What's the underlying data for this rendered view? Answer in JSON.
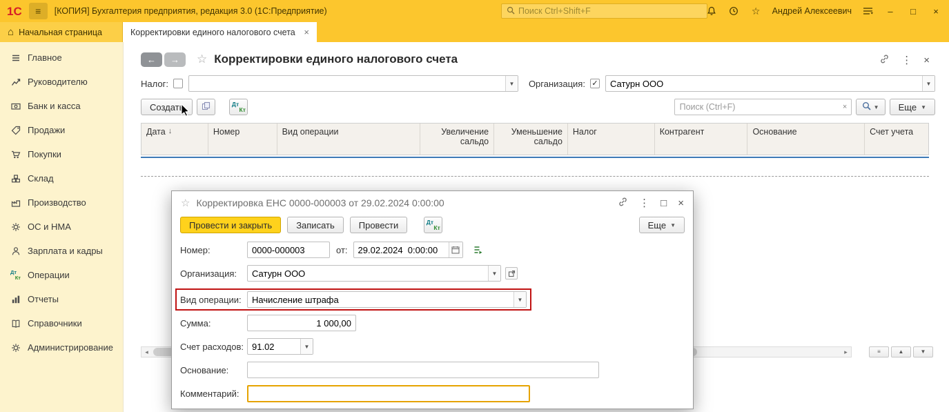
{
  "topbar": {
    "logo": "1С",
    "title": "[КОПИЯ] Бухгалтерия предприятия, редакция 3.0  (1С:Предприятие)",
    "search_placeholder": "Поиск Ctrl+Shift+F",
    "user_name": "Андрей Алексеевич"
  },
  "tabs": {
    "home": "Начальная страница",
    "active": "Корректировки единого налогового счета"
  },
  "sidebar": {
    "items": [
      "Главное",
      "Руководителю",
      "Банк и касса",
      "Продажи",
      "Покупки",
      "Склад",
      "Производство",
      "ОС и НМА",
      "Зарплата и кадры",
      "Операции",
      "Отчеты",
      "Справочники",
      "Администрирование"
    ]
  },
  "list": {
    "title": "Корректировки единого налогового счета",
    "tax_label": "Налог:",
    "org_label": "Организация:",
    "org_value": "Сатурн ООО",
    "create_button": "Создать",
    "search_placeholder": "Поиск (Ctrl+F)",
    "more_button": "Еще",
    "columns": [
      "Дата",
      "Номер",
      "Вид операции",
      "Увеличение сальдо",
      "Уменьшение сальдо",
      "Налог",
      "Контрагент",
      "Основание",
      "Счет учета"
    ],
    "rows": []
  },
  "dialog": {
    "title": "Корректировка ЕНС 0000-000003 от 29.02.2024 0:00:00",
    "buttons": {
      "post_close": "Провести и закрыть",
      "write": "Записать",
      "post": "Провести",
      "more": "Еще"
    },
    "fields": {
      "number": {
        "label": "Номер:",
        "value": "0000-000003"
      },
      "date": {
        "label": "от:",
        "value": "29.02.2024  0:00:00"
      },
      "organization": {
        "label": "Организация:",
        "value": "Сатурн ООО"
      },
      "operation": {
        "label": "Вид операции:",
        "value": "Начисление штрафа"
      },
      "amount": {
        "label": "Сумма:",
        "value": "1 000,00"
      },
      "expense_account": {
        "label": "Счет расходов:",
        "value": "91.02"
      },
      "basis": {
        "label": "Основание:",
        "value": ""
      },
      "comment": {
        "label": "Комментарий:",
        "value": ""
      }
    }
  },
  "icons": {
    "dt": "Дт",
    "kt": "Кт"
  },
  "colors": {
    "brand_yellow": "#fcc62d",
    "sidebar_yellow": "#fdf3cd",
    "primary_button": "#ffd21c",
    "highlight_red": "#c01212",
    "comment_warning": "#e6a300",
    "selection_blue": "#3e79b6",
    "logo_red": "#d61f26"
  }
}
